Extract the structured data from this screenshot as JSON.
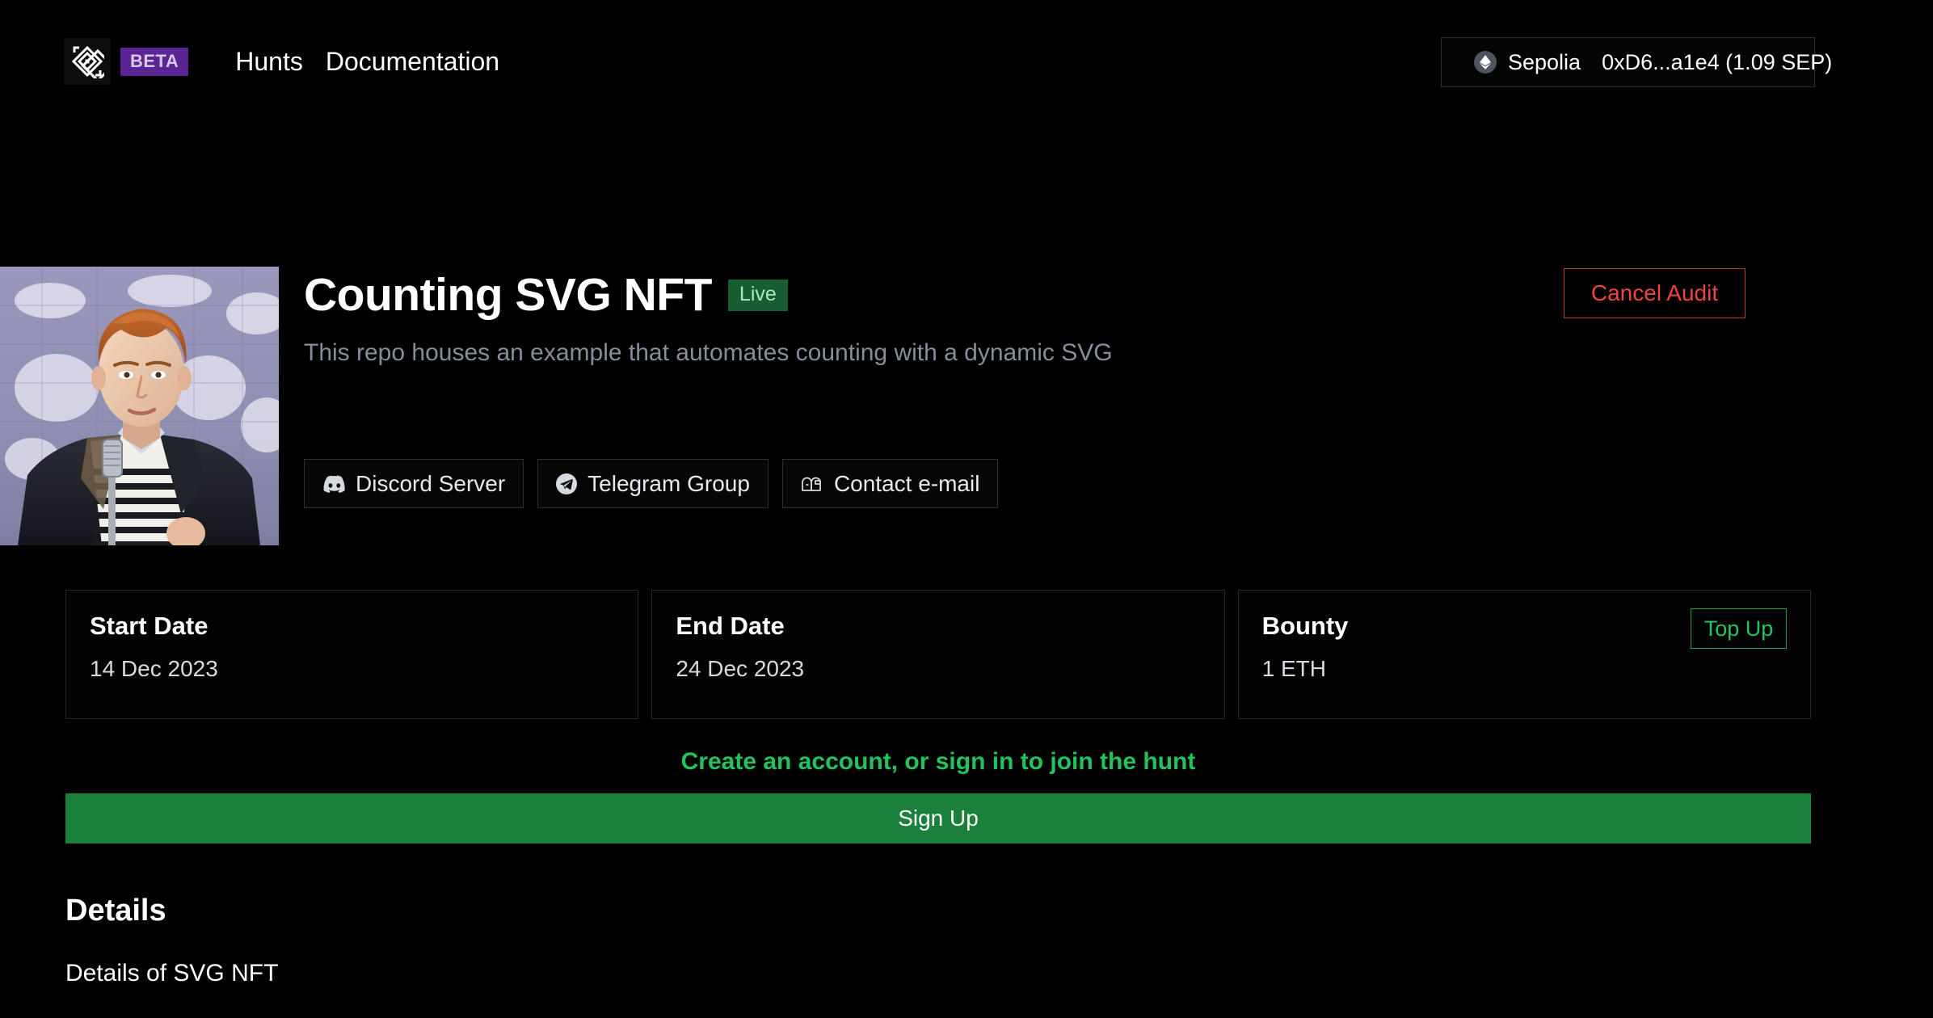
{
  "navbar": {
    "logo_icon": "concentric-diamond-logo",
    "beta_label": "BETA",
    "links": [
      {
        "label": "Hunts"
      },
      {
        "label": "Documentation"
      }
    ],
    "wallet": {
      "network_icon": "ethereum-icon",
      "network": "Sepolia",
      "address_balance": "0xD6...a1e4 (1.09 SEP)"
    }
  },
  "hero": {
    "thumbnail_alt": "hunt-thumbnail",
    "title": "Counting SVG NFT",
    "status_badge": "Live",
    "description": "This repo houses an example that automates counting with a dynamic SVG",
    "cancel_label": "Cancel Audit",
    "social_buttons": [
      {
        "icon": "discord-icon",
        "label": "Discord Server"
      },
      {
        "icon": "telegram-icon",
        "label": "Telegram Group"
      },
      {
        "icon": "mailbox-icon",
        "label": "Contact e-mail"
      }
    ]
  },
  "stats": [
    {
      "title": "Start Date",
      "value": "14 Dec 2023"
    },
    {
      "title": "End Date",
      "value": "24 Dec 2023"
    },
    {
      "title": "Bounty",
      "value": "1 ETH",
      "action_label": "Top Up"
    }
  ],
  "signup": {
    "prompt": "Create an account, or sign in to join the hunt",
    "button_label": "Sign Up"
  },
  "details": {
    "heading": "Details",
    "body": "Details of SVG NFT"
  },
  "colors": {
    "background": "#000000",
    "beta_purple": "#5b2494",
    "live_green_bg": "#175f33",
    "accent_green": "#22c55e",
    "signup_green": "#1b803b",
    "danger_red": "#ef4444",
    "card_border": "#212835",
    "muted_text": "#868d9b"
  }
}
